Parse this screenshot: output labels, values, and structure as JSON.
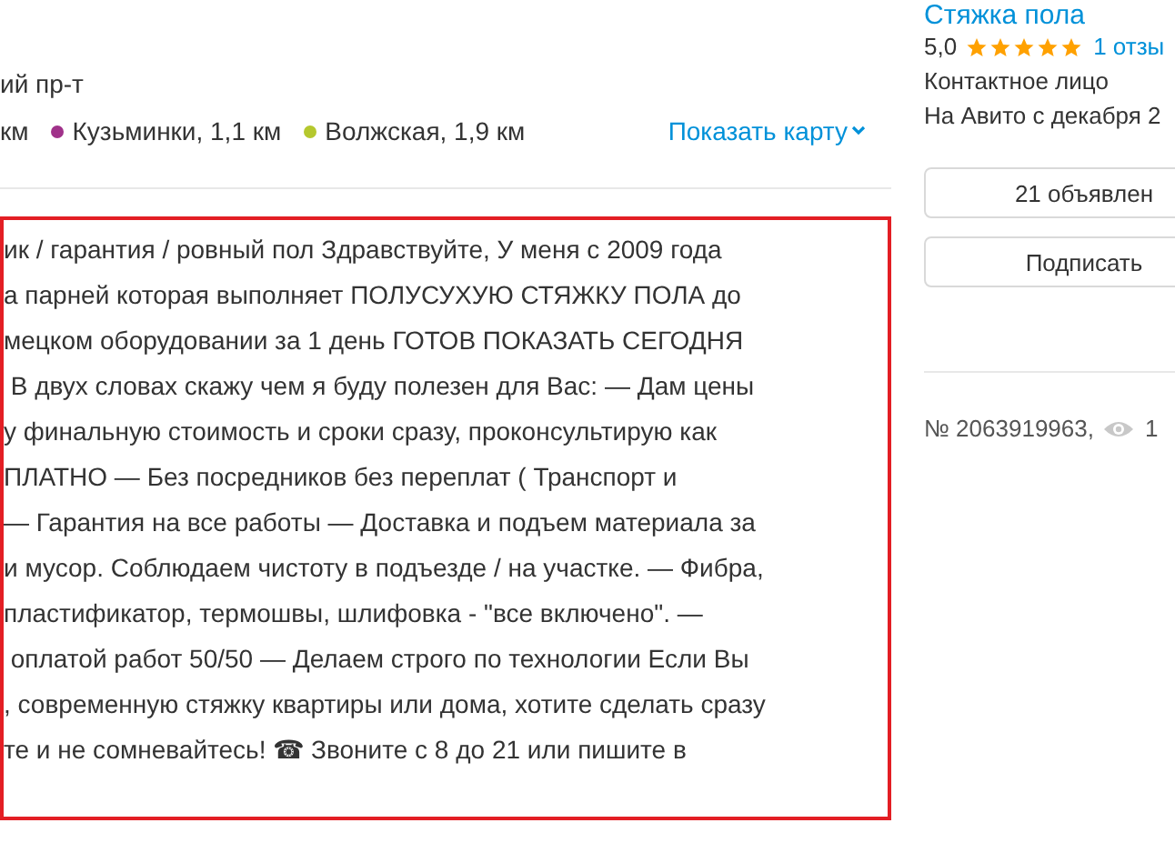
{
  "address": {
    "street": "ий пр-т",
    "metro": [
      {
        "name": "км"
      },
      {
        "name": "Кузьминки, 1,1 км",
        "color": "#a0328a"
      },
      {
        "name": "Волжская, 1,9 км",
        "color": "#b5c82e"
      }
    ],
    "map_link": "Показать карту"
  },
  "description": {
    "lines": [
      "ик / гарантия / ровный пол Здравствуйте, У меня с 2009 года",
      "а парней которая выполняет ПОЛУСУХУЮ СТЯЖКУ ПОЛА до",
      "мецком оборудовании за 1 день ГОТОВ ПОКАЗАТЬ СЕГОДНЯ",
      " В двух словах скажу чем я буду полезен для Вас: — Дам цены",
      "у финальную стоимость и сроки сразу, проконсультирую как",
      "ПЛАТНО — Без посредников без переплат ( Транспорт и",
      "— Гарантия на все работы — Доставка и подъем материала за",
      "и мусор. Соблюдаем чистоту в подъезде / на участке. — Фибра,",
      "пластификатор, термошвы, шлифовка - \"все включено\". —",
      " оплатой работ 50/50 — Делаем строго по технологии Если Вы",
      ", современную стяжку квартиры или дома, хотите сделать сразу",
      "те и не сомневайтесь! ☎ Звоните с 8 до 21 или пишите в"
    ]
  },
  "seller": {
    "name": "Стяжка пола",
    "rating": "5,0",
    "stars": 5,
    "reviews": "1 отзы",
    "role": "Контактное лицо",
    "since": "На Авито с декабря 2"
  },
  "buttons": [
    "21 объявлен",
    "Подписать"
  ],
  "ad": {
    "number": "№ 2063919963,",
    "views": "1"
  }
}
